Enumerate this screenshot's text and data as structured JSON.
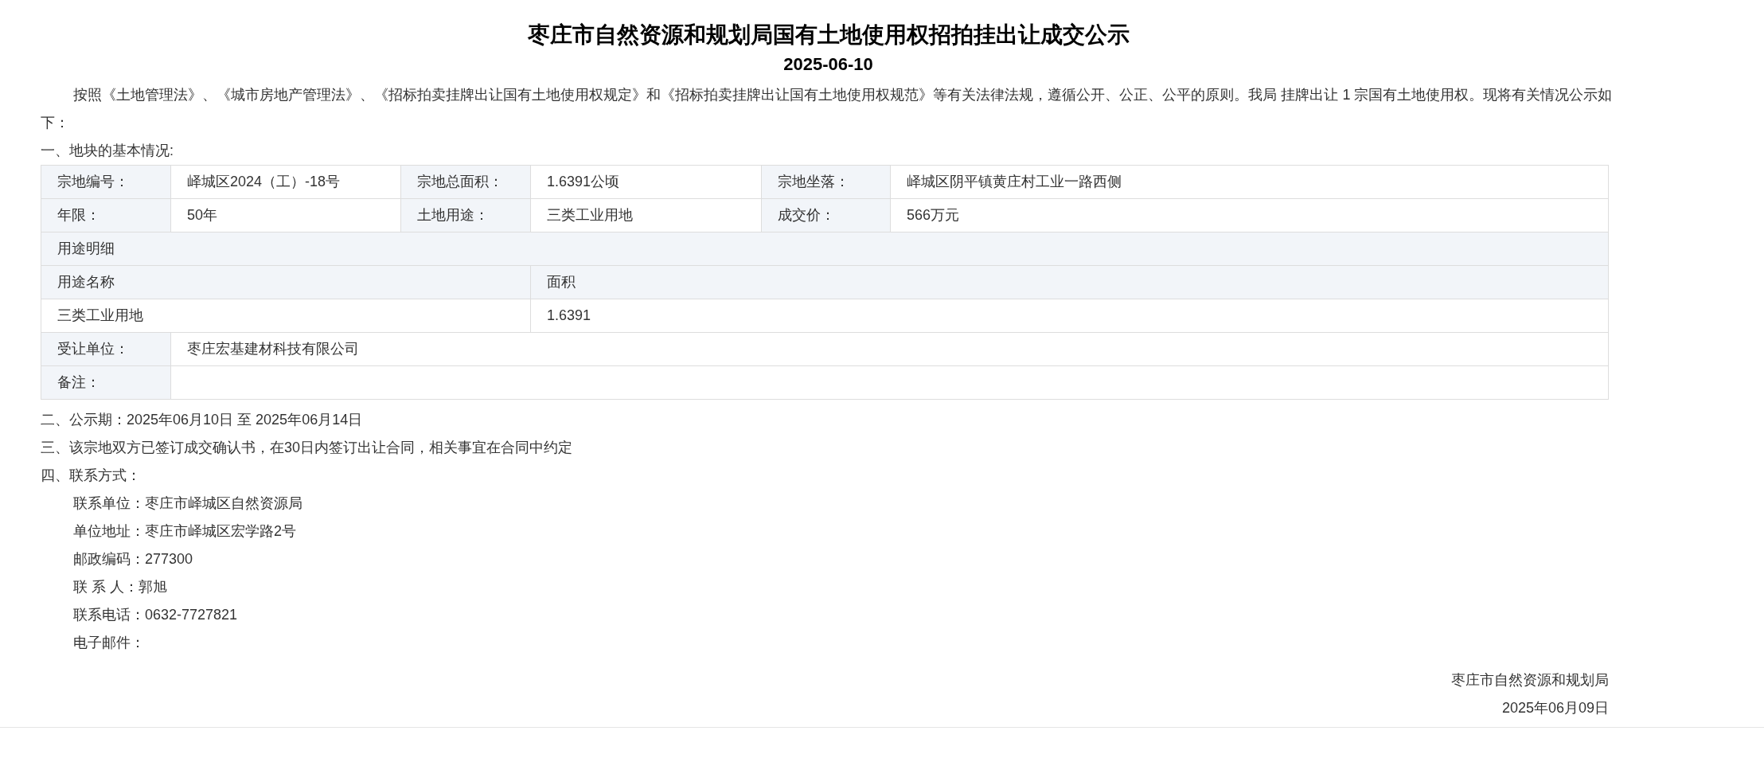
{
  "title": "枣庄市自然资源和规划局国有土地使用权招拍挂出让成交公示",
  "date": "2025-06-10",
  "intro": "按照《土地管理法》、《城市房地产管理法》、《招标拍卖挂牌出让国有土地使用权规定》和《招标拍卖挂牌出让国有土地使用权规范》等有关法律法规，遵循公开、公正、公平的原则。我局 挂牌出让 1 宗国有土地使用权。现将有关情况公示如下：",
  "section_1": "一、地块的基本情况:",
  "table": {
    "info_rows": [
      [
        {
          "label": "宗地编号：",
          "value": "峄城区2024（工）-18号"
        },
        {
          "label": "宗地总面积：",
          "value": "1.6391公顷"
        },
        {
          "label": "宗地坐落：",
          "value": "峄城区阴平镇黄庄村工业一路西侧"
        }
      ],
      [
        {
          "label": "年限：",
          "value": "50年"
        },
        {
          "label": "土地用途：",
          "value": "三类工业用地"
        },
        {
          "label": "成交价：",
          "value": "566万元"
        }
      ]
    ],
    "detail_header": "用途明细",
    "detail_columns": [
      "用途名称",
      "面积"
    ],
    "detail_rows": [
      [
        "三类工业用地",
        "1.6391"
      ]
    ],
    "extra_rows": [
      {
        "label": "受让单位：",
        "value": "枣庄宏基建材科技有限公司"
      },
      {
        "label": "备注："
      }
    ]
  },
  "sections": [
    "二、公示期：2025年06月10日 至 2025年06月14日",
    "三、该宗地双方已签订成交确认书，在30日内签订出让合同，相关事宜在合同中约定",
    "四、联系方式："
  ],
  "contacts": [
    "联系单位：枣庄市峄城区自然资源局",
    "单位地址：枣庄市峄城区宏学路2号",
    "邮政编码：277300",
    "联 系 人：郭旭",
    "联系电话：0632-7727821",
    "电子邮件："
  ],
  "signature": {
    "issuer": "枣庄市自然资源和规划局",
    "date": "2025年06月09日"
  }
}
